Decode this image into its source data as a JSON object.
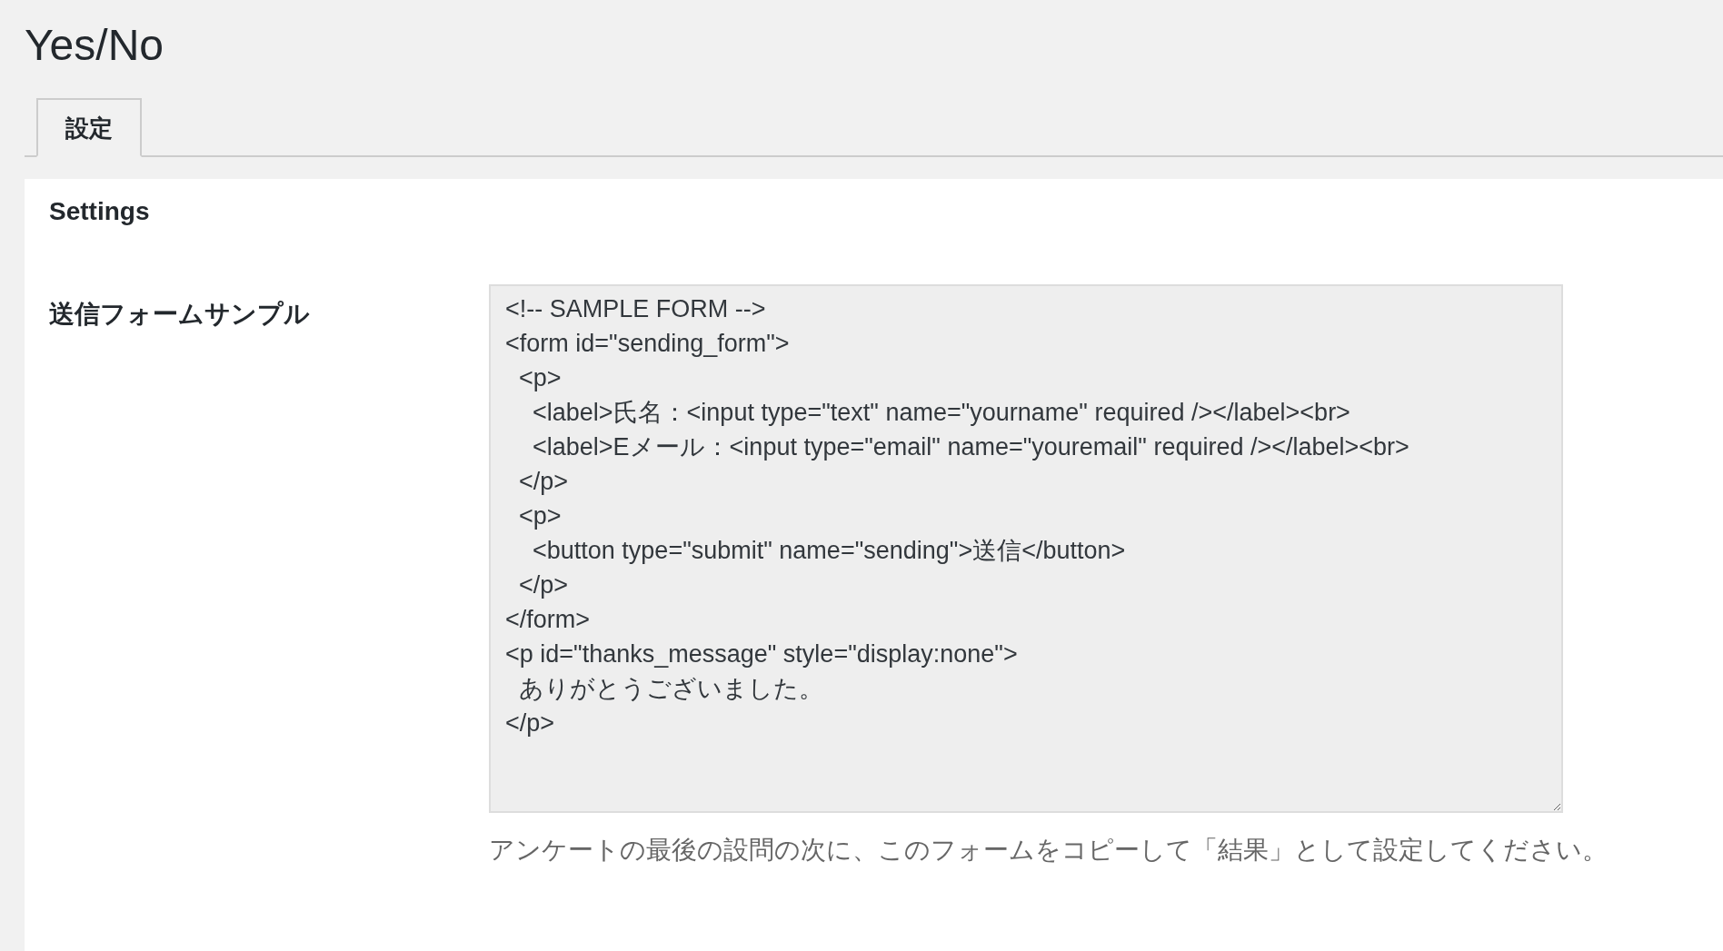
{
  "page_title": "Yes/No",
  "tabs": [
    {
      "label": "設定",
      "selected": true
    }
  ],
  "panel": {
    "heading": "Settings",
    "fields": [
      {
        "label": "送信フォームサンプル",
        "value": "<!-- SAMPLE FORM -->\n<form id=\"sending_form\">\n  <p>\n    <label>氏名：<input type=\"text\" name=\"yourname\" required /></label><br>\n    <label>Eメール：<input type=\"email\" name=\"youremail\" required /></label><br>\n  </p>\n  <p>\n    <button type=\"submit\" name=\"sending\">送信</button>\n  </p>\n</form>\n<p id=\"thanks_message\" style=\"display:none\">\n  ありがとうございました。\n</p>",
        "description": "アンケートの最後の設問の次に、このフォームをコピーして「結果」として設定してください。"
      }
    ]
  }
}
